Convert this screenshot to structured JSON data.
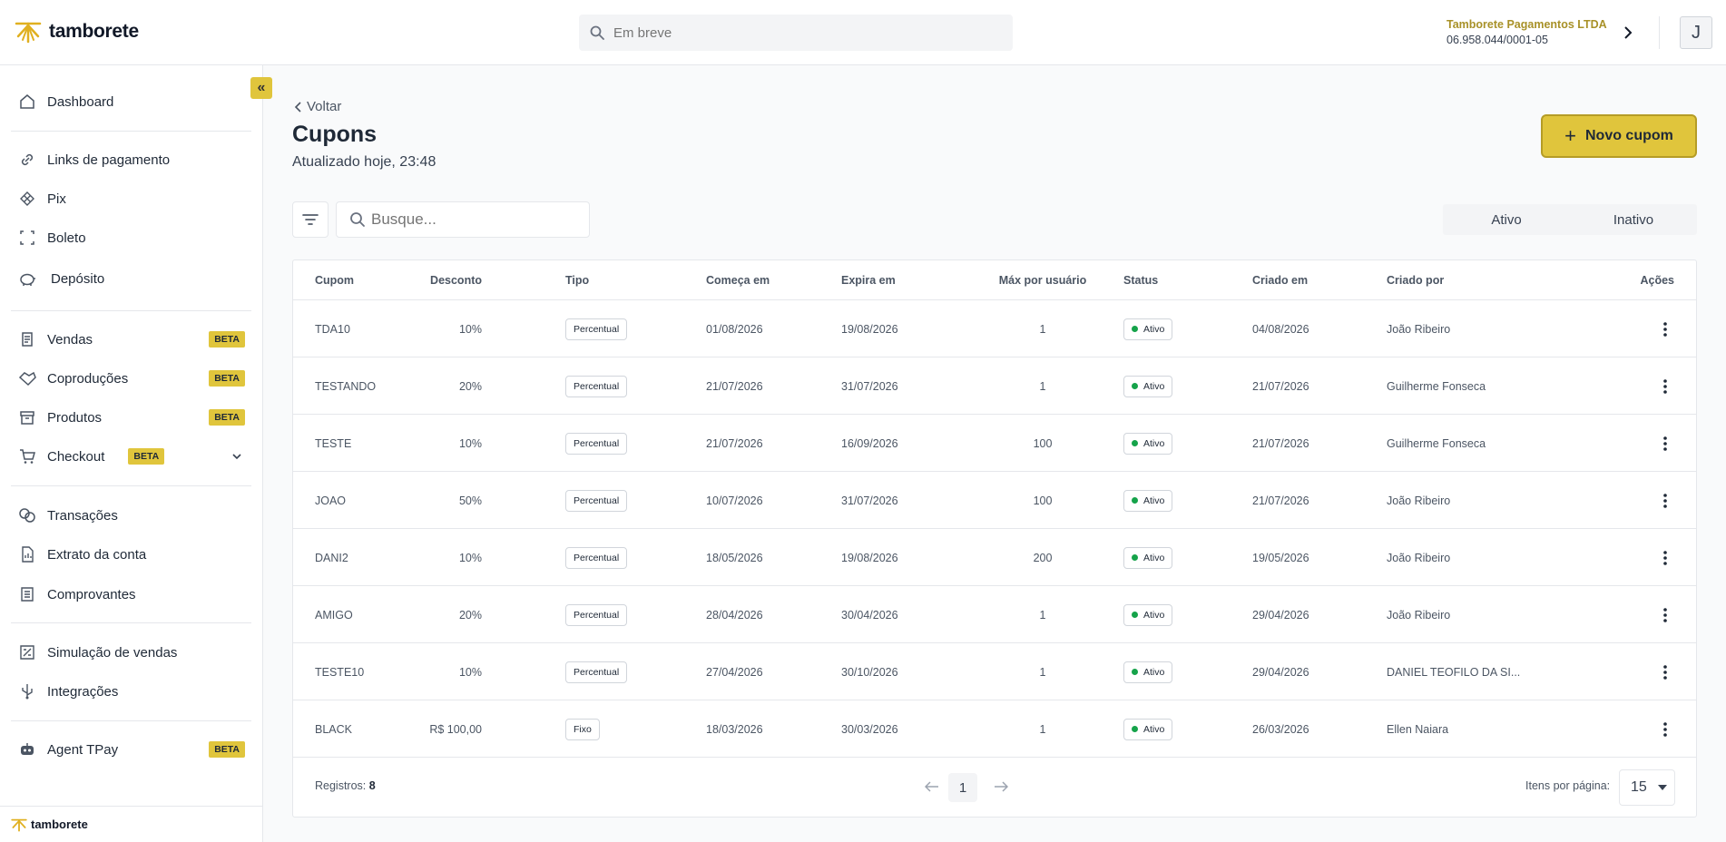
{
  "header": {
    "logo_text": "tamborete",
    "search_placeholder": "Em breve",
    "company_name": "Tamborete Pagamentos LTDA",
    "company_doc": "06.958.044/0001-05",
    "avatar_initial": "J"
  },
  "sidebar": {
    "items": [
      {
        "label": "Dashboard",
        "icon": "home-icon"
      },
      {
        "label": "Links de pagamento",
        "icon": "link-icon"
      },
      {
        "label": "Pix",
        "icon": "pix-icon"
      },
      {
        "label": "Boleto",
        "icon": "barcode-icon"
      },
      {
        "label": "Depósito",
        "icon": "piggy-bank-icon"
      },
      {
        "label": "Vendas",
        "icon": "receipt-icon",
        "badge": "BETA"
      },
      {
        "label": "Coproduções",
        "icon": "handshake-icon",
        "badge": "BETA"
      },
      {
        "label": "Produtos",
        "icon": "box-icon",
        "badge": "BETA"
      },
      {
        "label": "Checkout",
        "icon": "cart-icon",
        "badge": "BETA"
      },
      {
        "label": "Transações",
        "icon": "transactions-icon"
      },
      {
        "label": "Extrato da conta",
        "icon": "statement-icon"
      },
      {
        "label": "Comprovantes",
        "icon": "list-icon"
      },
      {
        "label": "Simulação de vendas",
        "icon": "calculator-icon"
      },
      {
        "label": "Integrações",
        "icon": "usb-icon"
      },
      {
        "label": "Agent TPay",
        "icon": "robot-icon",
        "badge": "BETA"
      }
    ],
    "footer_logo": "tamborete"
  },
  "page": {
    "back_label": "Voltar",
    "title": "Cupons",
    "updated": "Atualizado hoje, 23:48",
    "new_button": "Novo cupom",
    "search_placeholder": "Busque...",
    "toggle": [
      "Ativo",
      "Inativo"
    ]
  },
  "table": {
    "columns": [
      "Cupom",
      "Desconto",
      "Tipo",
      "Começa em",
      "Expira em",
      "Máx por usuário",
      "Status",
      "Criado em",
      "Criado por",
      "Ações"
    ],
    "rows": [
      {
        "cupom": "TDA10",
        "desconto": "10%",
        "tipo": "Percentual",
        "inicio": "01/08/2026",
        "expira": "19/08/2026",
        "max": "1",
        "status": "Ativo",
        "criado": "04/08/2026",
        "por": "João Ribeiro"
      },
      {
        "cupom": "TESTANDO",
        "desconto": "20%",
        "tipo": "Percentual",
        "inicio": "21/07/2026",
        "expira": "31/07/2026",
        "max": "1",
        "status": "Ativo",
        "criado": "21/07/2026",
        "por": "Guilherme Fonseca"
      },
      {
        "cupom": "TESTE",
        "desconto": "10%",
        "tipo": "Percentual",
        "inicio": "21/07/2026",
        "expira": "16/09/2026",
        "max": "100",
        "status": "Ativo",
        "criado": "21/07/2026",
        "por": "Guilherme Fonseca"
      },
      {
        "cupom": "JOAO",
        "desconto": "50%",
        "tipo": "Percentual",
        "inicio": "10/07/2026",
        "expira": "31/07/2026",
        "max": "100",
        "status": "Ativo",
        "criado": "21/07/2026",
        "por": "João Ribeiro"
      },
      {
        "cupom": "DANI2",
        "desconto": "10%",
        "tipo": "Percentual",
        "inicio": "18/05/2026",
        "expira": "19/08/2026",
        "max": "200",
        "status": "Ativo",
        "criado": "19/05/2026",
        "por": "João Ribeiro"
      },
      {
        "cupom": "AMIGO",
        "desconto": "20%",
        "tipo": "Percentual",
        "inicio": "28/04/2026",
        "expira": "30/04/2026",
        "max": "1",
        "status": "Ativo",
        "criado": "29/04/2026",
        "por": "João Ribeiro"
      },
      {
        "cupom": "TESTE10",
        "desconto": "10%",
        "tipo": "Percentual",
        "inicio": "27/04/2026",
        "expira": "30/10/2026",
        "max": "1",
        "status": "Ativo",
        "criado": "29/04/2026",
        "por": "DANIEL TEOFILO DA SI..."
      },
      {
        "cupom": "BLACK",
        "desconto": "R$ 100,00",
        "tipo": "Fixo",
        "inicio": "18/03/2026",
        "expira": "30/03/2026",
        "max": "1",
        "status": "Ativo",
        "criado": "26/03/2026",
        "por": "Ellen Naiara"
      }
    ],
    "records_label": "Registros:",
    "records_count": "8",
    "current_page": "1",
    "items_per_page_label": "Itens por página:",
    "items_per_page": "15"
  },
  "colors": {
    "accent": "#e0c53c",
    "status_active": "#15a34a",
    "company": "#a89128"
  }
}
